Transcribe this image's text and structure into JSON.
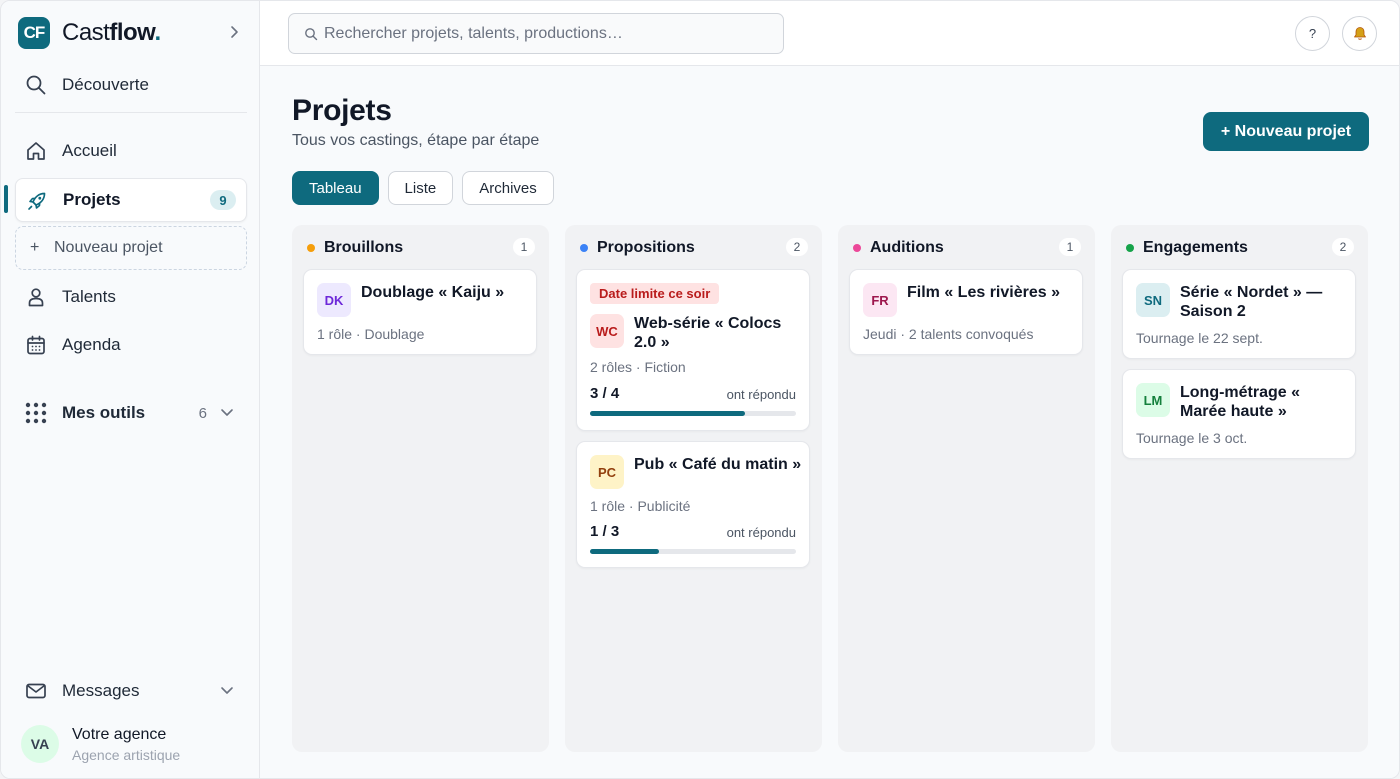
{
  "app": {
    "name_part1": "Cast",
    "name_part2": "flow",
    "name_dot": ".",
    "logo_text": "CF",
    "accent_color": "#0e6a7e"
  },
  "sidebar": {
    "discover_label": "Découverte",
    "items": [
      {
        "label": "Accueil",
        "icon": "home-icon"
      },
      {
        "label": "Projets",
        "icon": "rocket-icon",
        "count": "9",
        "active": true
      },
      {
        "label": "Talents",
        "icon": "person-icon"
      },
      {
        "label": "Agenda",
        "icon": "calendar-icon"
      }
    ],
    "new_project_label": "Nouveau projet",
    "tools_label": "Mes outils",
    "tools_count": "6",
    "messages_label": "Messages",
    "user": {
      "initials": "VA",
      "name": "Votre agence",
      "role": "Agence artistique"
    }
  },
  "topbar": {
    "search_placeholder": "Rechercher projets, talents, productions…",
    "search_value": "",
    "help_label": "?"
  },
  "page": {
    "title": "Projets",
    "subtitle": "Tous vos castings, étape par étape",
    "new_project_button": "+ Nouveau projet",
    "tabs": [
      {
        "label": "Tableau",
        "active": true
      },
      {
        "label": "Liste",
        "active": false
      },
      {
        "label": "Archives",
        "active": false
      }
    ]
  },
  "columns": [
    {
      "title": "Brouillons",
      "count": "1",
      "dot_color": "#f59e0b",
      "cards": [
        {
          "initials": "DK",
          "badge_bg": "#ede9fe",
          "badge_fg": "#6d28d9",
          "title": "Doublage « Kaiju »",
          "meta": "1 rôle · Doublage"
        }
      ]
    },
    {
      "title": "Propositions",
      "count": "2",
      "dot_color": "#3b82f6",
      "cards": [
        {
          "deadline": "Date limite ce soir",
          "initials": "WC",
          "badge_bg": "#fee2e2",
          "badge_fg": "#b91c1c",
          "title": "Web-série « Colocs 2.0 »",
          "meta": "2 rôles · Fiction",
          "progress": {
            "value": "3 / 4",
            "label": "ont répondu",
            "fraction": 0.75
          }
        },
        {
          "initials": "PC",
          "badge_bg": "#fef3c7",
          "badge_fg": "#92400e",
          "title": "Pub « Café du matin »",
          "meta": "1 rôle · Publicité",
          "progress": {
            "value": "1 / 3",
            "label": "ont répondu",
            "fraction": 0.3333
          }
        }
      ]
    },
    {
      "title": "Auditions",
      "count": "1",
      "dot_color": "#ec4899",
      "cards": [
        {
          "initials": "FR",
          "badge_bg": "#fce7f3",
          "badge_fg": "#9d174d",
          "title": "Film « Les rivières »",
          "meta": "Jeudi · 2 talents convoqués"
        }
      ]
    },
    {
      "title": "Engagements",
      "count": "2",
      "dot_color": "#16a34a",
      "cards": [
        {
          "initials": "SN",
          "badge_bg": "#dbeef1",
          "badge_fg": "#0e6a7e",
          "title": "Série « Nordet » — Saison 2",
          "meta": "Tournage le 22 sept."
        },
        {
          "initials": "LM",
          "badge_bg": "#dcfce7",
          "badge_fg": "#15803d",
          "title": "Long-métrage « Marée haute »",
          "meta": "Tournage le 3 oct."
        }
      ]
    }
  ]
}
